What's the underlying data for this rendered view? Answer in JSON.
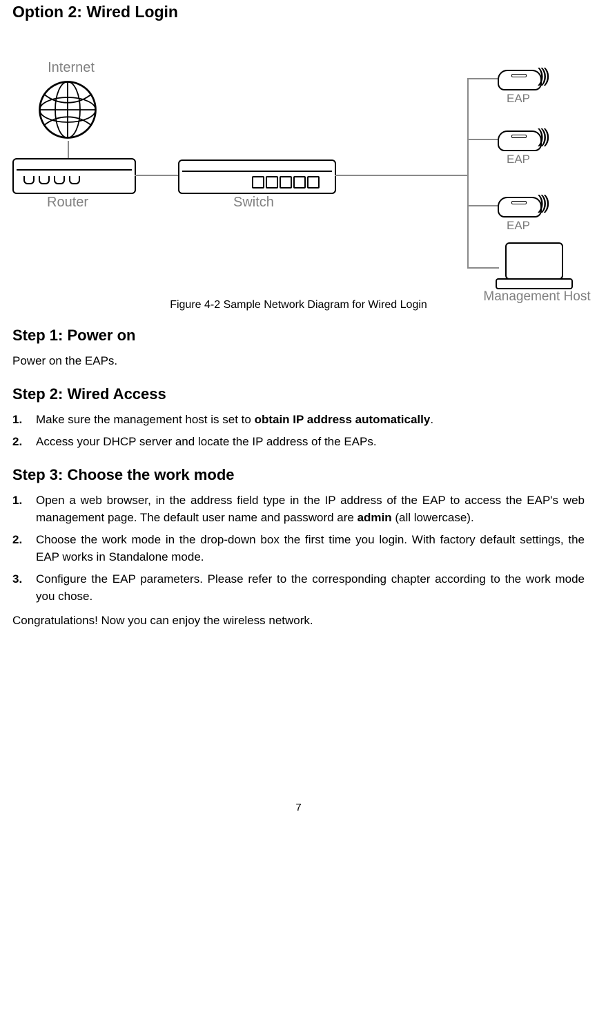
{
  "option_heading": "Option 2: Wired Login",
  "figure_caption": "Figure 4-2 Sample Network Diagram for Wired Login",
  "diagram": {
    "internet": "Internet",
    "router": "Router",
    "switch": "Switch",
    "eap": "EAP",
    "management_host": "Management Host"
  },
  "step1": {
    "heading": "Step 1: Power on",
    "body": "Power on the EAPs."
  },
  "step2": {
    "heading": "Step 2: Wired Access",
    "items": {
      "1": {
        "num": "1.",
        "pre": "Make sure the management host is set to ",
        "bold": "obtain IP address automatically",
        "post": "."
      },
      "2": {
        "num": "2.",
        "text": "Access your DHCP server and locate the IP address of the EAPs."
      }
    }
  },
  "step3": {
    "heading": "Step 3: Choose the work mode",
    "items": {
      "1": {
        "num": "1.",
        "pre": "Open a web browser, in the address field type in the IP address of the EAP to access the EAP's web management page. The default user name and password are ",
        "bold": "admin",
        "post": " (all lowercase)."
      },
      "2": {
        "num": "2.",
        "text": "Choose the work mode in the drop-down box the first time you login. With factory default settings, the EAP works in Standalone mode."
      },
      "3": {
        "num": "3.",
        "text": "Configure the EAP parameters. Please refer to the corresponding chapter according to the work mode you chose."
      }
    }
  },
  "closing": "Congratulations! Now you can enjoy the wireless network.",
  "page_number": "7"
}
